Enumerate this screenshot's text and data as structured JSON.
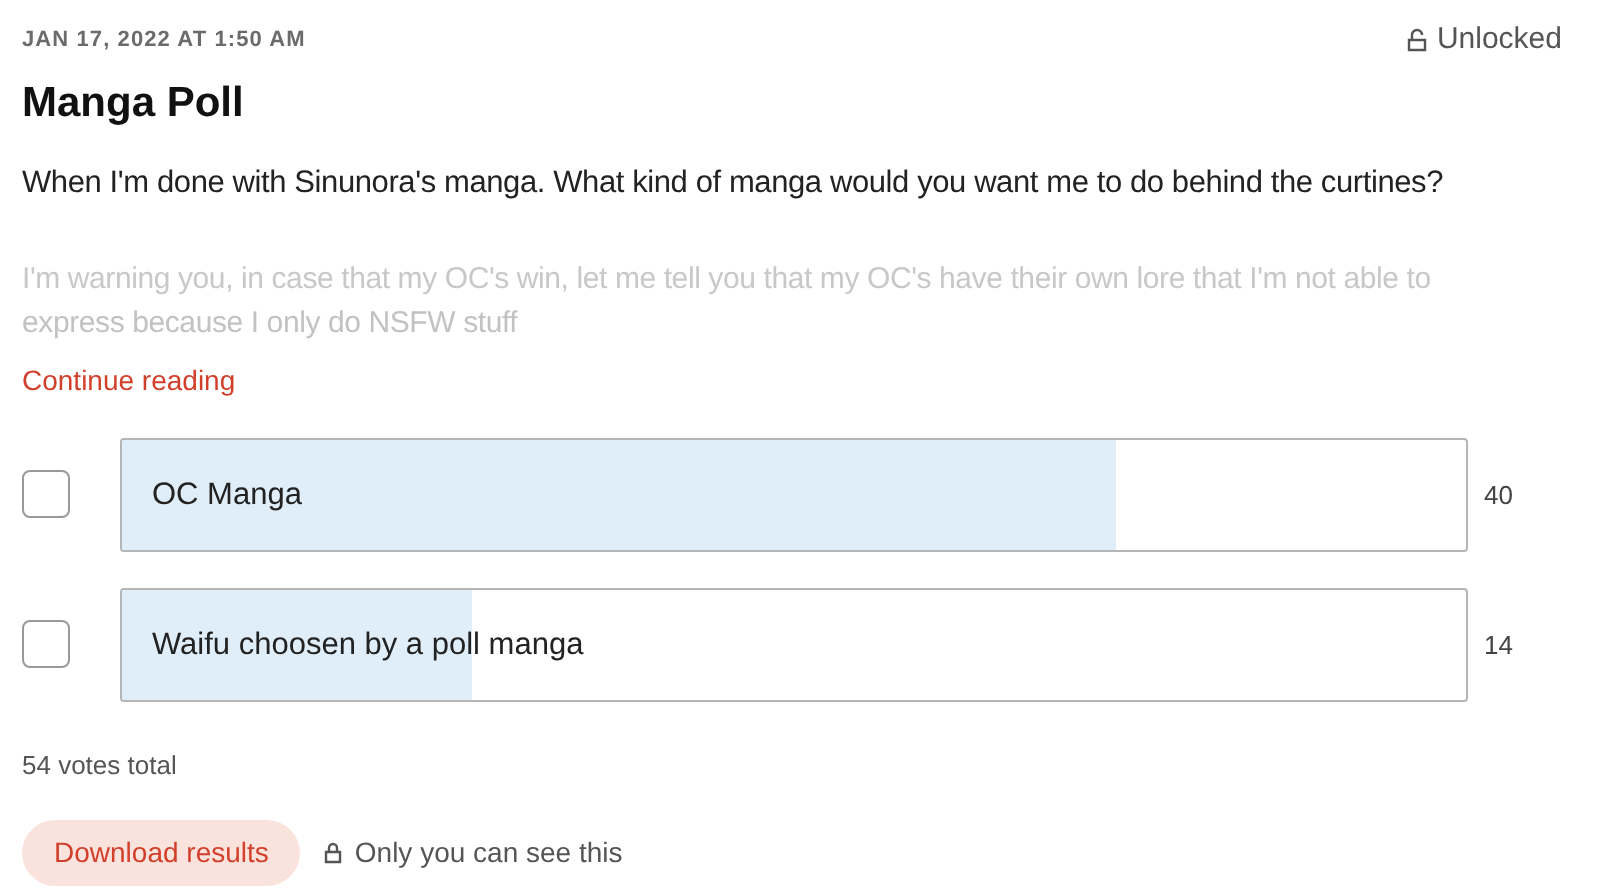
{
  "post": {
    "date": "JAN 17, 2022 AT 1:50 AM",
    "access": "Unlocked",
    "title": "Manga Poll",
    "question": "When I'm done with Sinunora's manga. What kind of manga would you want me to do behind the curtines?",
    "teaser_lines": [
      "I'm warning you, in case that my OC's win, let me tell you that my OC's have their own lore that I'm not able to",
      "express because I only do NSFW stuff"
    ],
    "continue_link": "Continue reading"
  },
  "poll": {
    "options": [
      {
        "label": "OC Manga",
        "checked": false,
        "level": 0.74,
        "count": "40"
      },
      {
        "label": "Waifu choosen by a poll manga",
        "checked": false,
        "level": 0.26,
        "count": "14"
      }
    ],
    "total": "54 votes total",
    "download_button": "Download results",
    "privacy_note": "Only you can see this"
  }
}
